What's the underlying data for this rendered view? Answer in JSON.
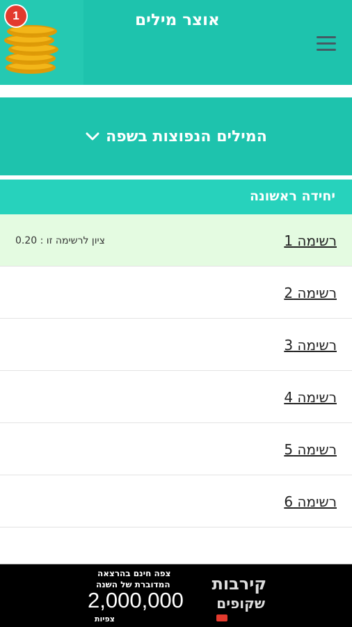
{
  "header": {
    "title": "אוצר מילים",
    "coins_count": "1"
  },
  "section": {
    "title": "המילים הנפוצות בשפה"
  },
  "unit": {
    "title": "יחידה ראשונה"
  },
  "lists": [
    {
      "label": "רשימה 1",
      "score": "ציון לרשימה זו : 0.20"
    },
    {
      "label": "רשימה 2"
    },
    {
      "label": "רשימה 3"
    },
    {
      "label": "רשימה 4"
    },
    {
      "label": "רשימה 5"
    },
    {
      "label": "רשימה 6"
    }
  ],
  "ad": {
    "line1": "צפה חינם בהרצאה",
    "line2": "המדוברת של השנה",
    "views": "2,000,000",
    "views_label": "צפיות",
    "logo_title": "קירבות",
    "logo_subtitle": "שקופים"
  },
  "colors": {
    "primary": "#1ec3ad",
    "unit_bar": "#27d2bc",
    "active_row": "#e4fbe1",
    "badge": "#e33a2e"
  }
}
